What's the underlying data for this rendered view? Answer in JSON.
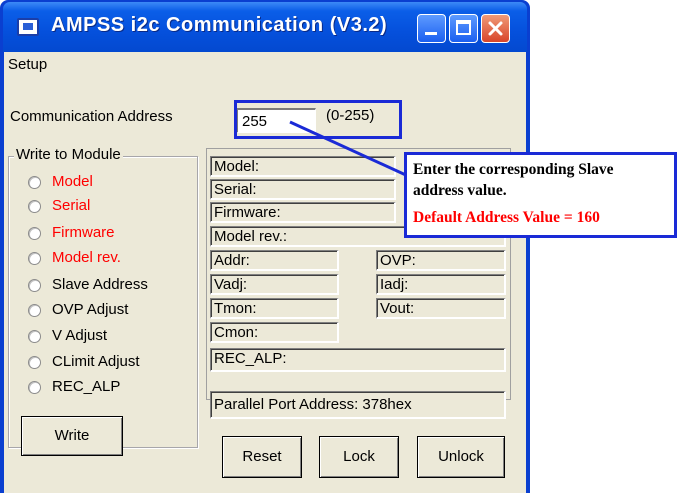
{
  "window": {
    "title": "AMPSS i2c Communication (V3.2)"
  },
  "menubar": {
    "setup": "Setup"
  },
  "communication": {
    "label": "Communication Address",
    "value": "255",
    "range": "(0-255)"
  },
  "write_group": {
    "title": "Write to Module",
    "options": [
      {
        "label": "Model",
        "highlight": true
      },
      {
        "label": "Serial",
        "highlight": true
      },
      {
        "label": "Firmware",
        "highlight": true
      },
      {
        "label": "Model rev.",
        "highlight": true
      },
      {
        "label": "Slave Address",
        "highlight": false
      },
      {
        "label": "OVP Adjust",
        "highlight": false
      },
      {
        "label": "V Adjust",
        "highlight": false
      },
      {
        "label": "CLimit Adjust",
        "highlight": false
      },
      {
        "label": "REC_ALP",
        "highlight": false
      }
    ],
    "write_button": "Write"
  },
  "info_fields": {
    "model": "Model:",
    "serial": "Serial:",
    "firmware": "Firmware:",
    "model_rev": "Model rev.:",
    "addr": "Addr:",
    "ovp": "OVP:",
    "vadj": "Vadj:",
    "iadj": "Iadj:",
    "tmon": "Tmon:",
    "vout": "Vout:",
    "cmon": "Cmon:",
    "rec_alp": "REC_ALP:",
    "parallel_port": "Parallel Port Address: 378hex"
  },
  "buttons": {
    "reset": "Reset",
    "lock": "Lock",
    "unlock": "Unlock"
  },
  "callout": {
    "line1": "Enter the corresponding Slave",
    "line2": "address value.",
    "line3": "Default Address Value = 160"
  },
  "colors": {
    "highlight_red": "#ff0000",
    "annotation_blue": "#1a2ad6",
    "xp_title_blue": "#0550dc"
  }
}
